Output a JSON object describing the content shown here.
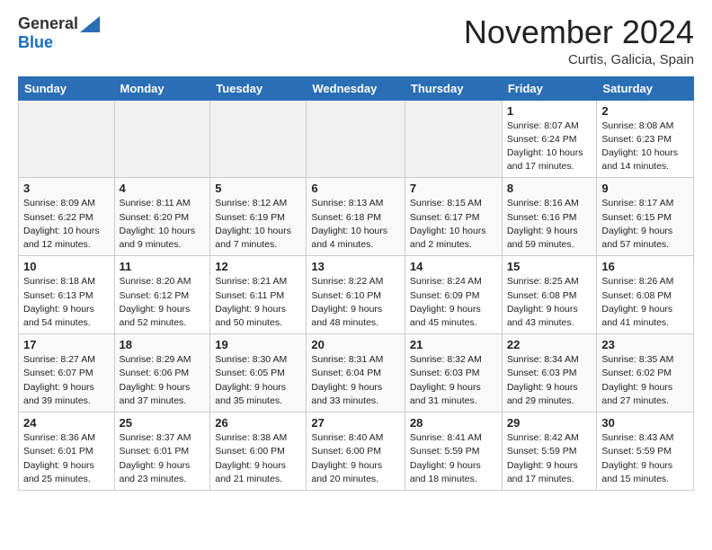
{
  "header": {
    "logo_general": "General",
    "logo_blue": "Blue",
    "month_title": "November 2024",
    "location": "Curtis, Galicia, Spain"
  },
  "days_of_week": [
    "Sunday",
    "Monday",
    "Tuesday",
    "Wednesday",
    "Thursday",
    "Friday",
    "Saturday"
  ],
  "weeks": [
    {
      "days": [
        {
          "date": "",
          "empty": true
        },
        {
          "date": "",
          "empty": true
        },
        {
          "date": "",
          "empty": true
        },
        {
          "date": "",
          "empty": true
        },
        {
          "date": "",
          "empty": true
        },
        {
          "date": "1",
          "sunrise": "Sunrise: 8:07 AM",
          "sunset": "Sunset: 6:24 PM",
          "daylight": "Daylight: 10 hours and 17 minutes."
        },
        {
          "date": "2",
          "sunrise": "Sunrise: 8:08 AM",
          "sunset": "Sunset: 6:23 PM",
          "daylight": "Daylight: 10 hours and 14 minutes."
        }
      ]
    },
    {
      "days": [
        {
          "date": "3",
          "sunrise": "Sunrise: 8:09 AM",
          "sunset": "Sunset: 6:22 PM",
          "daylight": "Daylight: 10 hours and 12 minutes."
        },
        {
          "date": "4",
          "sunrise": "Sunrise: 8:11 AM",
          "sunset": "Sunset: 6:20 PM",
          "daylight": "Daylight: 10 hours and 9 minutes."
        },
        {
          "date": "5",
          "sunrise": "Sunrise: 8:12 AM",
          "sunset": "Sunset: 6:19 PM",
          "daylight": "Daylight: 10 hours and 7 minutes."
        },
        {
          "date": "6",
          "sunrise": "Sunrise: 8:13 AM",
          "sunset": "Sunset: 6:18 PM",
          "daylight": "Daylight: 10 hours and 4 minutes."
        },
        {
          "date": "7",
          "sunrise": "Sunrise: 8:15 AM",
          "sunset": "Sunset: 6:17 PM",
          "daylight": "Daylight: 10 hours and 2 minutes."
        },
        {
          "date": "8",
          "sunrise": "Sunrise: 8:16 AM",
          "sunset": "Sunset: 6:16 PM",
          "daylight": "Daylight: 9 hours and 59 minutes."
        },
        {
          "date": "9",
          "sunrise": "Sunrise: 8:17 AM",
          "sunset": "Sunset: 6:15 PM",
          "daylight": "Daylight: 9 hours and 57 minutes."
        }
      ]
    },
    {
      "days": [
        {
          "date": "10",
          "sunrise": "Sunrise: 8:18 AM",
          "sunset": "Sunset: 6:13 PM",
          "daylight": "Daylight: 9 hours and 54 minutes."
        },
        {
          "date": "11",
          "sunrise": "Sunrise: 8:20 AM",
          "sunset": "Sunset: 6:12 PM",
          "daylight": "Daylight: 9 hours and 52 minutes."
        },
        {
          "date": "12",
          "sunrise": "Sunrise: 8:21 AM",
          "sunset": "Sunset: 6:11 PM",
          "daylight": "Daylight: 9 hours and 50 minutes."
        },
        {
          "date": "13",
          "sunrise": "Sunrise: 8:22 AM",
          "sunset": "Sunset: 6:10 PM",
          "daylight": "Daylight: 9 hours and 48 minutes."
        },
        {
          "date": "14",
          "sunrise": "Sunrise: 8:24 AM",
          "sunset": "Sunset: 6:09 PM",
          "daylight": "Daylight: 9 hours and 45 minutes."
        },
        {
          "date": "15",
          "sunrise": "Sunrise: 8:25 AM",
          "sunset": "Sunset: 6:08 PM",
          "daylight": "Daylight: 9 hours and 43 minutes."
        },
        {
          "date": "16",
          "sunrise": "Sunrise: 8:26 AM",
          "sunset": "Sunset: 6:08 PM",
          "daylight": "Daylight: 9 hours and 41 minutes."
        }
      ]
    },
    {
      "days": [
        {
          "date": "17",
          "sunrise": "Sunrise: 8:27 AM",
          "sunset": "Sunset: 6:07 PM",
          "daylight": "Daylight: 9 hours and 39 minutes."
        },
        {
          "date": "18",
          "sunrise": "Sunrise: 8:29 AM",
          "sunset": "Sunset: 6:06 PM",
          "daylight": "Daylight: 9 hours and 37 minutes."
        },
        {
          "date": "19",
          "sunrise": "Sunrise: 8:30 AM",
          "sunset": "Sunset: 6:05 PM",
          "daylight": "Daylight: 9 hours and 35 minutes."
        },
        {
          "date": "20",
          "sunrise": "Sunrise: 8:31 AM",
          "sunset": "Sunset: 6:04 PM",
          "daylight": "Daylight: 9 hours and 33 minutes."
        },
        {
          "date": "21",
          "sunrise": "Sunrise: 8:32 AM",
          "sunset": "Sunset: 6:03 PM",
          "daylight": "Daylight: 9 hours and 31 minutes."
        },
        {
          "date": "22",
          "sunrise": "Sunrise: 8:34 AM",
          "sunset": "Sunset: 6:03 PM",
          "daylight": "Daylight: 9 hours and 29 minutes."
        },
        {
          "date": "23",
          "sunrise": "Sunrise: 8:35 AM",
          "sunset": "Sunset: 6:02 PM",
          "daylight": "Daylight: 9 hours and 27 minutes."
        }
      ]
    },
    {
      "days": [
        {
          "date": "24",
          "sunrise": "Sunrise: 8:36 AM",
          "sunset": "Sunset: 6:01 PM",
          "daylight": "Daylight: 9 hours and 25 minutes."
        },
        {
          "date": "25",
          "sunrise": "Sunrise: 8:37 AM",
          "sunset": "Sunset: 6:01 PM",
          "daylight": "Daylight: 9 hours and 23 minutes."
        },
        {
          "date": "26",
          "sunrise": "Sunrise: 8:38 AM",
          "sunset": "Sunset: 6:00 PM",
          "daylight": "Daylight: 9 hours and 21 minutes."
        },
        {
          "date": "27",
          "sunrise": "Sunrise: 8:40 AM",
          "sunset": "Sunset: 6:00 PM",
          "daylight": "Daylight: 9 hours and 20 minutes."
        },
        {
          "date": "28",
          "sunrise": "Sunrise: 8:41 AM",
          "sunset": "Sunset: 5:59 PM",
          "daylight": "Daylight: 9 hours and 18 minutes."
        },
        {
          "date": "29",
          "sunrise": "Sunrise: 8:42 AM",
          "sunset": "Sunset: 5:59 PM",
          "daylight": "Daylight: 9 hours and 17 minutes."
        },
        {
          "date": "30",
          "sunrise": "Sunrise: 8:43 AM",
          "sunset": "Sunset: 5:59 PM",
          "daylight": "Daylight: 9 hours and 15 minutes."
        }
      ]
    }
  ]
}
